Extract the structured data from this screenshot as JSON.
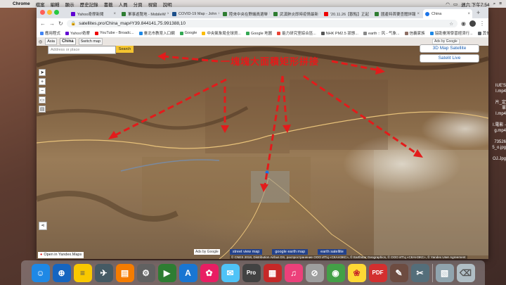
{
  "menubar": {
    "app": "Chrome",
    "items": [
      "檔案",
      "編輯",
      "顯示",
      "歷史記錄",
      "書籤",
      "人員",
      "分頁",
      "視窗",
      "說明"
    ],
    "clock": "週六 下午7:54"
  },
  "desktop_files": [
    "IUE'S",
    "I.mp4",
    "",
    "片_定單",
    "I.mp4",
    "",
    "I.電影 - ",
    "g.mp4",
    "",
    "73526",
    "5_o.jpg",
    "",
    "OJ.Jpg"
  ],
  "tabs": [
    {
      "label": "Yahoo奇摩新聞",
      "color": "#6001d2",
      "active": false
    },
    {
      "label": "軍事遊覽地 - MobileW",
      "color": "#2e7d32",
      "active": false
    },
    {
      "label": "COVID-19 Map - John",
      "color": "#1b4f8a",
      "active": false
    },
    {
      "label": "陸來中央在野議員選舉",
      "color": "#2e7d32",
      "active": false
    },
    {
      "label": "武漢肺炎即時疫情最新",
      "color": "#2e7d32",
      "active": false
    },
    {
      "label": "'20.11.26【觀點】正起",
      "color": "#e00",
      "active": false
    },
    {
      "label": "國產特首要查體詳報",
      "color": "#2e7d32",
      "active": false
    },
    {
      "label": "China",
      "color": "#1a73e8",
      "active": true
    }
  ],
  "address": "satellites.pro/China_map#Y39.844141,75.991388,10",
  "bookmarks": [
    "應用程式",
    "Yahoo!奇摩",
    "YouTube - Broadc...",
    "臺北市教育入口網",
    "Google",
    "中央氣象局全球資...",
    "Google 地圖",
    "能力研究室綜合區...",
    "NHK PM2.5 狀態...",
    "earth :: 风 - 气象...",
    "信義家族",
    "協助臺灣學習經濟行..."
  ],
  "bookmarks_other": "其他書籤",
  "sitebar": {
    "nav": "Asia",
    "region": "China",
    "switch": "Switch map"
  },
  "search": {
    "placeholder": "Address or place",
    "button": "Search"
  },
  "ads_label": "Ads by Google",
  "maptype": [
    "3D Map Satellite",
    "Satelit Live"
  ],
  "headline": "一塊塊大面積矩形拼接",
  "bottom": {
    "yandex": "Open in Yandex.Maps",
    "ads": "Ads by Google",
    "links": [
      "street view map",
      "google earth map",
      "earth satellite"
    ],
    "copyright": "© CNES 2018, Distribution Airbus DS, распространение ООО ИТЦ «СКАНЭКС», © Earthstar Geographics, © ООО ИТЦ «СКАНЭКС», © Yandex User Agreement"
  },
  "dock": [
    {
      "name": "finder",
      "color": "#1e88e5",
      "glyph": "☺"
    },
    {
      "name": "safari",
      "color": "#1565c0",
      "glyph": "⊕"
    },
    {
      "name": "notes",
      "color": "#f9c800",
      "glyph": "≡"
    },
    {
      "name": "launchpad",
      "color": "#455a64",
      "glyph": "✈"
    },
    {
      "name": "preview",
      "color": "#f57c00",
      "glyph": "▤"
    },
    {
      "name": "system-preferences",
      "color": "#616161",
      "glyph": "⚙"
    },
    {
      "name": "facetime",
      "color": "#2e7d32",
      "glyph": "▶"
    },
    {
      "name": "app-store",
      "color": "#1976d2",
      "glyph": "A"
    },
    {
      "name": "photos",
      "color": "#e91e63",
      "glyph": "✿"
    },
    {
      "name": "mail",
      "color": "#4fc3f7",
      "glyph": "✉"
    },
    {
      "name": "pro-app",
      "color": "#424242",
      "glyph": "P"
    },
    {
      "name": "photo-booth",
      "color": "#c62828",
      "glyph": "▦"
    },
    {
      "name": "itunes",
      "color": "#ec407a",
      "glyph": "♫"
    },
    {
      "name": "calendar",
      "color": "#9e9e9e",
      "glyph": "⊘"
    },
    {
      "name": "chrome",
      "color": "#43a047",
      "glyph": "◉"
    },
    {
      "name": "photos-app",
      "color": "#fdd835",
      "glyph": "❀"
    },
    {
      "name": "pdf-app",
      "color": "#d32f2f",
      "glyph": "PDF"
    },
    {
      "name": "paint-app",
      "color": "#6d4c41",
      "glyph": "✎"
    },
    {
      "name": "utilities",
      "color": "#546e7a",
      "glyph": "✂"
    },
    {
      "name": "preview-2",
      "color": "#90a4ae",
      "glyph": "▧"
    },
    {
      "name": "trash",
      "color": "#b0bec5",
      "glyph": "🗑"
    }
  ]
}
